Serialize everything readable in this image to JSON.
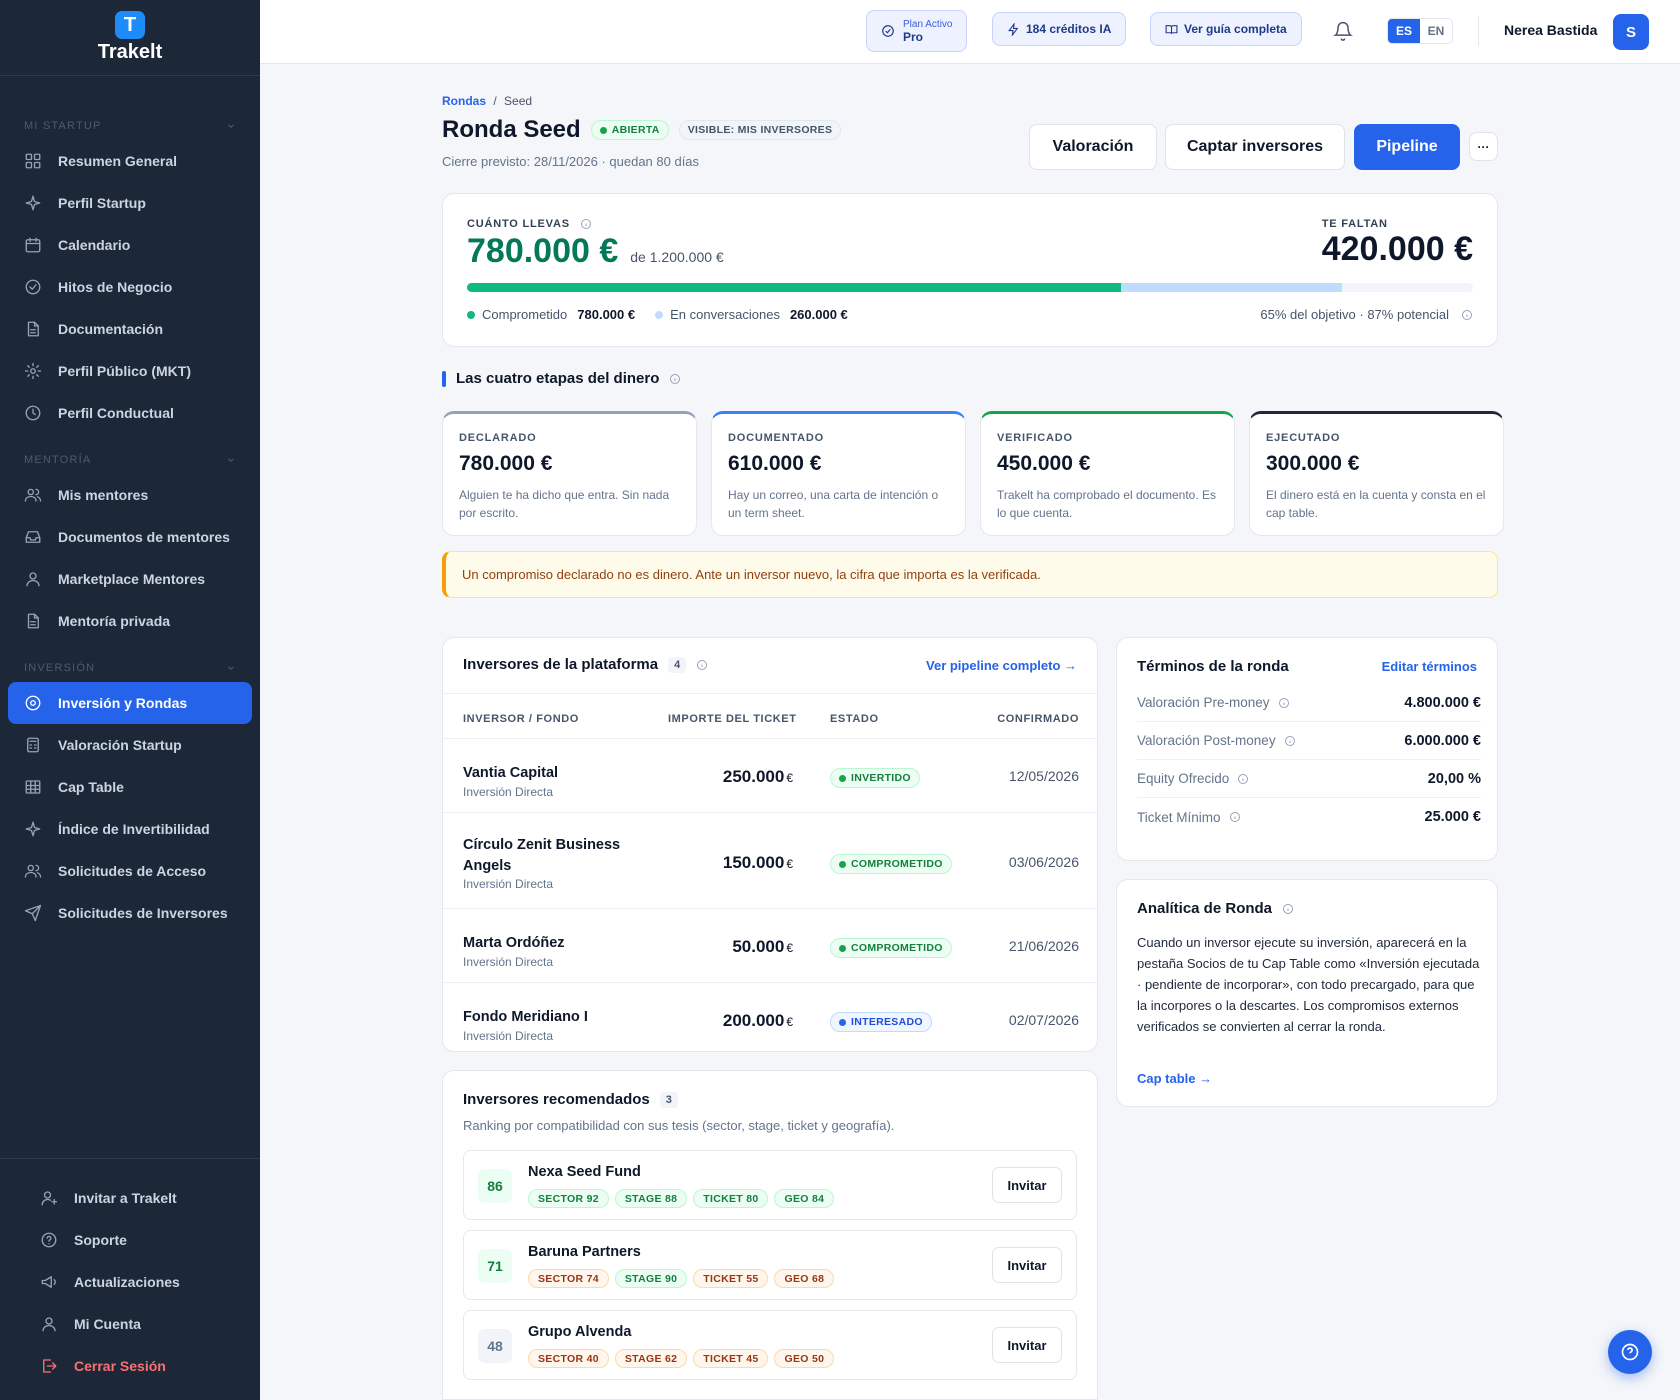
{
  "brand": {
    "name": "Trakelt",
    "logo_letter": "T"
  },
  "sidebar": {
    "sections": [
      {
        "title": "MI STARTUP",
        "items": [
          {
            "label": "Resumen General",
            "icon": "grid-icon"
          },
          {
            "label": "Perfil Startup",
            "icon": "sparkle-icon"
          },
          {
            "label": "Calendario",
            "icon": "calendar-icon"
          },
          {
            "label": "Hitos de Negocio",
            "icon": "check-circle-icon"
          },
          {
            "label": "Documentación",
            "icon": "document-icon"
          },
          {
            "label": "Perfil Público (MKT)",
            "icon": "gear-icon"
          },
          {
            "label": "Perfil Conductual",
            "icon": "clock-icon"
          }
        ]
      },
      {
        "title": "MENTORÍA",
        "items": [
          {
            "label": "Mis mentores",
            "icon": "users-icon"
          },
          {
            "label": "Documentos de mentores",
            "icon": "inbox-icon"
          },
          {
            "label": "Marketplace Mentores",
            "icon": "user-icon"
          },
          {
            "label": "Mentoría privada",
            "icon": "document-icon"
          }
        ]
      },
      {
        "title": "INVERSIÓN",
        "items": [
          {
            "label": "Inversión y Rondas",
            "icon": "target-icon",
            "active": true
          },
          {
            "label": "Valoración Startup",
            "icon": "calculator-icon"
          },
          {
            "label": "Cap Table",
            "icon": "table-icon"
          },
          {
            "label": "Índice de Invertibilidad",
            "icon": "sparkle-icon"
          },
          {
            "label": "Solicitudes de Acceso",
            "icon": "users-icon"
          },
          {
            "label": "Solicitudes de Inversores",
            "icon": "send-icon"
          }
        ]
      }
    ],
    "bottom": [
      {
        "label": "Invitar a Trakelt",
        "icon": "user-plus-icon"
      },
      {
        "label": "Soporte",
        "icon": "help-icon"
      },
      {
        "label": "Actualizaciones",
        "icon": "megaphone-icon"
      },
      {
        "label": "Mi Cuenta",
        "icon": "user-icon"
      },
      {
        "label": "Cerrar Sesión",
        "icon": "logout-icon",
        "danger": true
      }
    ]
  },
  "topbar": {
    "plan_label": "Plan Activo",
    "plan_value": "Pro",
    "credits": "184 créditos IA",
    "guide": "Ver guía completa",
    "lang_es": "ES",
    "lang_en": "EN",
    "user_name": "Nerea Bastida",
    "avatar_initial": "S"
  },
  "breadcrumb": {
    "parent": "Rondas",
    "sep": "/",
    "current": "Seed"
  },
  "round": {
    "title": "Ronda Seed",
    "status": "ABIERTA",
    "visibility": "VISIBLE: MIS INVERSORES",
    "closing": "Cierre previsto: 28/11/2026 · quedan 80 días"
  },
  "actions": {
    "valuation": "Valoración",
    "raise": "Captar inversores",
    "pipeline": "Pipeline",
    "more": "···"
  },
  "progress": {
    "label_raised": "CUÁNTO LLEVAS",
    "raised": "780.000 €",
    "of_target": "de 1.200.000 €",
    "label_missing": "TE FALTAN",
    "missing": "420.000 €",
    "committed_fraction": 0.65,
    "potential_fraction": 0.87,
    "legend_committed": "Comprometido",
    "legend_committed_value": "780.000 €",
    "legend_talks": "En conversaciones",
    "legend_talks_value": "260.000 €",
    "summary": "65% del objetivo · 87% potencial",
    "colors": {
      "committed": "#10b981",
      "talks": "#bfdbfe"
    }
  },
  "stages": {
    "title": "Las cuatro etapas del dinero",
    "items": [
      {
        "label": "DECLARADO",
        "value": "780.000 €",
        "desc": "Alguien te ha dicho que entra. Sin nada por escrito.",
        "color": "#94a3b8"
      },
      {
        "label": "DOCUMENTADO",
        "value": "610.000 €",
        "desc": "Hay un correo, una carta de intención o un term sheet.",
        "color": "#3b82f6"
      },
      {
        "label": "VERIFICADO",
        "value": "450.000 €",
        "desc": "Trakelt ha comprobado el documento. Es lo que cuenta.",
        "color": "#16a34a"
      },
      {
        "label": "EJECUTADO",
        "value": "300.000 €",
        "desc": "El dinero está en la cuenta y consta en el cap table.",
        "color": "#1e293b"
      }
    ]
  },
  "warning": "Un compromiso declarado no es dinero. Ante un inversor nuevo, la cifra que importa es la verificada.",
  "investors": {
    "title": "Inversores de la plataforma",
    "count": "4",
    "link": "Ver pipeline completo →",
    "headers": [
      "INVERSOR / FONDO",
      "IMPORTE DEL TICKET",
      "ESTADO",
      "CONFIRMADO"
    ],
    "rows": [
      {
        "name": "Vantia Capital",
        "type": "Inversión Directa",
        "amount": "250.000",
        "currency": "€",
        "status": "INVERTIDO",
        "date": "12/05/2026"
      },
      {
        "name": "Círculo Zenit Business Angels",
        "type": "Inversión Directa",
        "amount": "150.000",
        "currency": "€",
        "status": "COMPROMETIDO",
        "date": "03/06/2026"
      },
      {
        "name": "Marta Ordóñez",
        "type": "Inversión Directa",
        "amount": "50.000",
        "currency": "€",
        "status": "COMPROMETIDO",
        "date": "21/06/2026"
      },
      {
        "name": "Fondo Meridiano I",
        "type": "Inversión Directa",
        "amount": "200.000",
        "currency": "€",
        "status": "INTERESADO",
        "date": "02/07/2026"
      }
    ]
  },
  "terms": {
    "title": "Términos de la ronda",
    "edit": "Editar términos",
    "items": [
      {
        "k": "Valoración Pre-money",
        "v": "4.800.000 €"
      },
      {
        "k": "Valoración Post-money",
        "v": "6.000.000 €"
      },
      {
        "k": "Equity Ofrecido",
        "v": "20,00 %"
      },
      {
        "k": "Ticket Mínimo",
        "v": "25.000 €"
      }
    ]
  },
  "analytics": {
    "title": "Analítica de Ronda",
    "body": "Cuando un inversor ejecute su inversión, aparecerá en la pestaña Socios de tu Cap Table como «Inversión ejecutada · pendiente de incorporar», con todo precargado, para que la incorpores o la descartes. Los compromisos externos verificados se convierten al cerrar la ronda.",
    "link": "Cap table →"
  },
  "recommended": {
    "title": "Inversores recomendados",
    "count": "3",
    "subtitle": "Ranking por compatibilidad con sus tesis (sector, stage, ticket y geografía).",
    "invite": "Invitar",
    "items": [
      {
        "score": "86",
        "name": "Nexa Seed Fund",
        "chips": [
          "SECTOR 92",
          "STAGE 88",
          "TICKET 80",
          "GEO 84"
        ],
        "tones": [
          "g",
          "g",
          "g",
          "g"
        ]
      },
      {
        "score": "71",
        "name": "Baruna Partners",
        "chips": [
          "SECTOR 74",
          "STAGE 90",
          "TICKET 55",
          "GEO 68"
        ],
        "tones": [
          "o",
          "g",
          "o",
          "o"
        ]
      },
      {
        "score": "48",
        "name": "Grupo Alvenda",
        "chips": [
          "SECTOR 40",
          "STAGE 62",
          "TICKET 45",
          "GEO 50"
        ],
        "tones": [
          "o",
          "o",
          "o",
          "o"
        ]
      }
    ]
  }
}
